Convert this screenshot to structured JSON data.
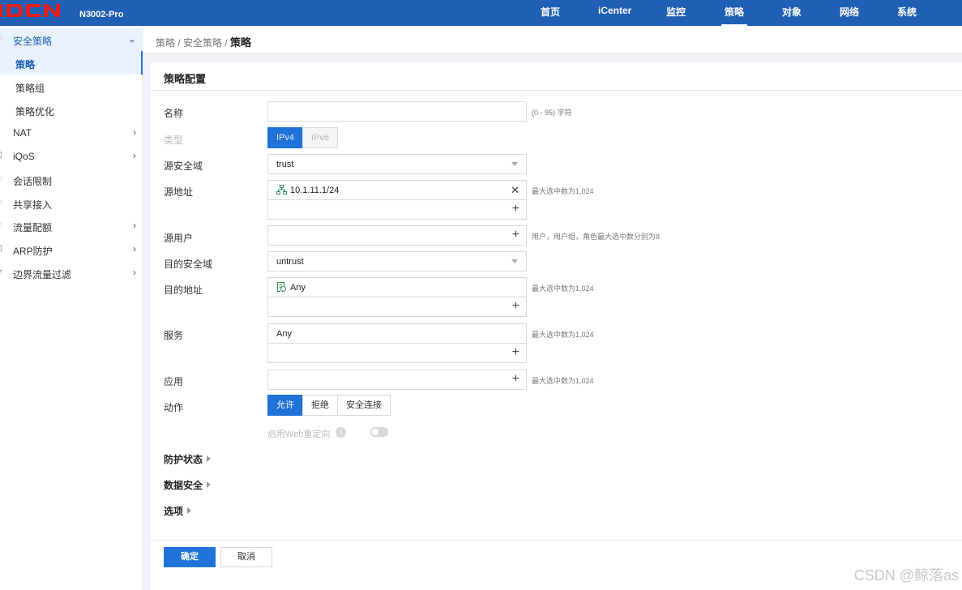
{
  "header": {
    "model": "N3002-Pro",
    "nav": [
      {
        "label": "首页"
      },
      {
        "label": "iCenter"
      },
      {
        "label": "监控"
      },
      {
        "label": "策略",
        "active": true
      },
      {
        "label": "对象"
      },
      {
        "label": "网络"
      },
      {
        "label": "系统"
      }
    ],
    "brand_color": "#1f5fb4",
    "logo_color": "#e02020"
  },
  "sidebar": {
    "groups": [
      {
        "label": "安全策略",
        "icon": "shield-icon",
        "expanded": true
      },
      {
        "label": "NAT",
        "icon": "nat-icon"
      },
      {
        "label": "iQoS",
        "icon": "qos-icon"
      },
      {
        "label": "会话限制",
        "icon": "session-icon"
      },
      {
        "label": "共享接入",
        "icon": "share-icon"
      },
      {
        "label": "流量配额",
        "icon": "quota-icon"
      },
      {
        "label": "ARP防护",
        "icon": "arp-icon"
      },
      {
        "label": "边界流量过滤",
        "icon": "filter-icon"
      }
    ],
    "sub_items": [
      {
        "label": "策略",
        "active": true
      },
      {
        "label": "策略组"
      },
      {
        "label": "策略优化"
      }
    ]
  },
  "breadcrumb": {
    "path": "策略 / 安全策略 / ",
    "current": "策略"
  },
  "form": {
    "title": "策略配置",
    "name": {
      "label": "名称",
      "value": "",
      "hint": "(0 - 95) 字符"
    },
    "type": {
      "label": "类型",
      "options": [
        "IPv4",
        "IPv6"
      ],
      "selected": "IPv4"
    },
    "src_zone": {
      "label": "源安全域",
      "value": "trust"
    },
    "src_addr": {
      "label": "源地址",
      "item": "10.1.11.1/24",
      "hint": "最大选中数为1,024"
    },
    "src_user": {
      "label": "源用户",
      "hint": "用户，用户组，角色最大选中数分别为8"
    },
    "dst_zone": {
      "label": "目的安全域",
      "value": "untrust"
    },
    "dst_addr": {
      "label": "目的地址",
      "item": "Any",
      "hint": "最大选中数为1,024"
    },
    "service": {
      "label": "服务",
      "item": "Any",
      "hint": "最大选中数为1,024"
    },
    "app": {
      "label": "应用",
      "hint": "最大选中数为1,024"
    },
    "action": {
      "label": "动作",
      "options": [
        "允许",
        "拒绝",
        "安全连接"
      ],
      "selected": "允许"
    },
    "web_redirect": {
      "label": "启用Web重定向",
      "enabled": false
    },
    "sections": [
      "防护状态",
      "数据安全",
      "选项"
    ],
    "ok_label": "确定",
    "cancel_label": "取消"
  },
  "watermark": "CSDN @鲸落as"
}
